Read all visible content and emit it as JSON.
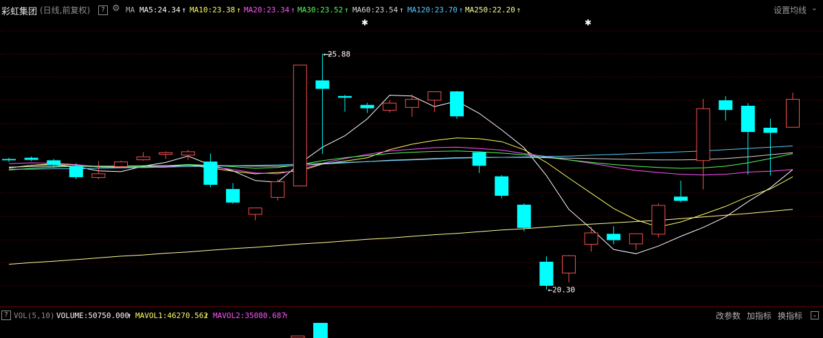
{
  "header": {
    "stock_name": "彩虹集团",
    "mode": "(日线,前复权)",
    "help": "?",
    "ma_label": "MA",
    "setting_label": "设置均线",
    "dropdown_glyph": "⌄",
    "indicators": [
      {
        "text": "MA5:24.34",
        "arrow": "↑",
        "color": "#ffffff"
      },
      {
        "text": "MA10:23.38",
        "arrow": "↑",
        "color": "#ffff66"
      },
      {
        "text": "MA20:23.34",
        "arrow": "↑",
        "color": "#ff55ff"
      },
      {
        "text": "MA30:23.52",
        "arrow": "↑",
        "color": "#55ff55"
      },
      {
        "text": "MA60:23.54",
        "arrow": "↑",
        "color": "#d8d8d8"
      },
      {
        "text": "MA120:23.70",
        "arrow": "↑",
        "color": "#55ccff"
      },
      {
        "text": "MA250:22.20",
        "arrow": "↑",
        "color": "#ffff99"
      }
    ]
  },
  "volume_panel": {
    "help": "?",
    "label": "VOL(5,10)",
    "volume": "VOLUME:50750.000",
    "volume_arrow": "↑",
    "mavol1": "MAVOL1:46270.562",
    "mavol1_arrow": "↑",
    "mavol2": "MAVOL2:35080.687",
    "mavol2_arrow": "↑",
    "buttons": [
      "改参数",
      "加指标",
      "换指标"
    ],
    "dropdown_glyph": "⌄"
  },
  "colors": {
    "up": "#ff5050",
    "down": "#00ffff",
    "grid": "#8b0000",
    "label": "#ffffff"
  },
  "chart_data": {
    "type": "candlestick",
    "ylim": [
      20.0,
      26.6
    ],
    "annotations": [
      {
        "label": "25.88",
        "value": 25.88,
        "kind": "high"
      },
      {
        "label": "20.30",
        "value": 20.3,
        "kind": "low"
      }
    ],
    "event_markers": [
      "✱",
      "✱"
    ],
    "candles": [
      {
        "o": 23.39,
        "h": 23.42,
        "l": 23.32,
        "c": 23.36
      },
      {
        "o": 23.42,
        "h": 23.45,
        "l": 23.34,
        "c": 23.37
      },
      {
        "o": 23.36,
        "h": 23.39,
        "l": 23.18,
        "c": 23.25
      },
      {
        "o": 23.22,
        "h": 23.29,
        "l": 22.91,
        "c": 22.96
      },
      {
        "o": 22.96,
        "h": 23.34,
        "l": 22.91,
        "c": 23.05
      },
      {
        "o": 23.22,
        "h": 23.35,
        "l": 23.17,
        "c": 23.33
      },
      {
        "o": 23.38,
        "h": 23.55,
        "l": 23.35,
        "c": 23.45
      },
      {
        "o": 23.51,
        "h": 23.57,
        "l": 23.39,
        "c": 23.55
      },
      {
        "o": 23.49,
        "h": 23.61,
        "l": 23.37,
        "c": 23.57
      },
      {
        "o": 23.33,
        "h": 23.52,
        "l": 22.72,
        "c": 22.78
      },
      {
        "o": 22.68,
        "h": 22.82,
        "l": 22.33,
        "c": 22.36
      },
      {
        "o": 22.09,
        "h": 22.24,
        "l": 21.94,
        "c": 22.24
      },
      {
        "o": 22.49,
        "h": 22.91,
        "l": 22.41,
        "c": 22.86
      },
      {
        "o": 22.76,
        "h": 25.62,
        "l": 22.74,
        "c": 25.62
      },
      {
        "o": 25.25,
        "h": 25.88,
        "l": 23.51,
        "c": 25.05
      },
      {
        "o": 24.88,
        "h": 24.91,
        "l": 24.51,
        "c": 24.84
      },
      {
        "o": 24.67,
        "h": 24.72,
        "l": 24.48,
        "c": 24.59
      },
      {
        "o": 24.55,
        "h": 24.78,
        "l": 24.49,
        "c": 24.72
      },
      {
        "o": 24.62,
        "h": 24.92,
        "l": 24.39,
        "c": 24.81
      },
      {
        "o": 24.79,
        "h": 24.99,
        "l": 24.5,
        "c": 24.99
      },
      {
        "o": 24.99,
        "h": 25.0,
        "l": 24.34,
        "c": 24.4
      },
      {
        "o": 23.55,
        "h": 23.57,
        "l": 23.06,
        "c": 23.23
      },
      {
        "o": 22.98,
        "h": 23.01,
        "l": 22.46,
        "c": 22.52
      },
      {
        "o": 22.31,
        "h": 22.34,
        "l": 21.68,
        "c": 21.76
      },
      {
        "o": 20.96,
        "h": 21.09,
        "l": 20.3,
        "c": 20.39
      },
      {
        "o": 20.7,
        "h": 21.12,
        "l": 20.47,
        "c": 21.11
      },
      {
        "o": 21.38,
        "h": 21.79,
        "l": 21.2,
        "c": 21.65
      },
      {
        "o": 21.62,
        "h": 21.8,
        "l": 21.37,
        "c": 21.47
      },
      {
        "o": 21.39,
        "h": 21.63,
        "l": 21.24,
        "c": 21.63
      },
      {
        "o": 21.62,
        "h": 22.34,
        "l": 21.53,
        "c": 22.3
      },
      {
        "o": 22.5,
        "h": 22.88,
        "l": 22.37,
        "c": 22.4
      },
      {
        "o": 23.36,
        "h": 24.81,
        "l": 22.67,
        "c": 24.59
      },
      {
        "o": 24.78,
        "h": 24.88,
        "l": 24.3,
        "c": 24.55
      },
      {
        "o": 24.65,
        "h": 24.71,
        "l": 23.02,
        "c": 24.03
      },
      {
        "o": 24.13,
        "h": 24.34,
        "l": 23.0,
        "c": 24.01
      },
      {
        "o": 24.15,
        "h": 24.96,
        "l": 24.15,
        "c": 24.81
      }
    ],
    "series": [
      {
        "name": "MA5",
        "color": "#ffffff",
        "values": [
          23.18,
          23.24,
          23.26,
          23.21,
          23.11,
          23.09,
          23.22,
          23.31,
          23.46,
          23.25,
          23.11,
          22.88,
          22.84,
          23.29,
          23.67,
          23.94,
          24.34,
          24.9,
          24.88,
          24.63,
          24.76,
          24.47,
          24.08,
          23.66,
          23.0,
          22.2,
          21.74,
          21.25,
          21.15,
          21.33,
          21.56,
          21.77,
          22.02,
          22.38,
          22.71,
          23.14
        ]
      },
      {
        "name": "MA10",
        "color": "#ffff66",
        "values": [
          23.18,
          23.24,
          23.28,
          23.25,
          23.21,
          23.21,
          23.19,
          23.2,
          23.25,
          23.18,
          23.1,
          23.04,
          23.07,
          23.11,
          23.27,
          23.34,
          23.42,
          23.61,
          23.74,
          23.83,
          23.89,
          23.87,
          23.8,
          23.61,
          23.31,
          22.94,
          22.58,
          22.22,
          21.95,
          21.78,
          21.9,
          22.08,
          22.27,
          22.5,
          22.68,
          22.97
        ]
      },
      {
        "name": "MA20",
        "color": "#ff55ff",
        "values": [
          23.28,
          23.3,
          23.29,
          23.26,
          23.2,
          23.18,
          23.2,
          23.21,
          23.25,
          23.21,
          23.14,
          23.06,
          23.04,
          23.14,
          23.29,
          23.4,
          23.5,
          23.58,
          23.62,
          23.66,
          23.67,
          23.64,
          23.6,
          23.52,
          23.45,
          23.37,
          23.29,
          23.2,
          23.12,
          23.07,
          23.03,
          23.01,
          23.03,
          23.08,
          23.1,
          23.14
        ]
      },
      {
        "name": "MA30",
        "color": "#55ff55",
        "values": [
          23.13,
          23.17,
          23.2,
          23.22,
          23.21,
          23.2,
          23.21,
          23.23,
          23.26,
          23.24,
          23.21,
          23.17,
          23.19,
          23.26,
          23.35,
          23.42,
          23.47,
          23.52,
          23.55,
          23.57,
          23.58,
          23.56,
          23.53,
          23.49,
          23.43,
          23.37,
          23.31,
          23.26,
          23.22,
          23.19,
          23.17,
          23.18,
          23.22,
          23.3,
          23.4,
          23.52
        ]
      },
      {
        "name": "MA60",
        "color": "#d8d8d8",
        "values": [
          23.2,
          23.21,
          23.22,
          23.22,
          23.22,
          23.22,
          23.23,
          23.23,
          23.24,
          23.24,
          23.23,
          23.22,
          23.22,
          23.24,
          23.27,
          23.3,
          23.33,
          23.36,
          23.38,
          23.4,
          23.42,
          23.43,
          23.43,
          23.43,
          23.42,
          23.41,
          23.4,
          23.39,
          23.38,
          23.37,
          23.37,
          23.38,
          23.4,
          23.44,
          23.49,
          23.54
        ]
      },
      {
        "name": "MA120",
        "color": "#55ccff",
        "values": [
          23.15,
          23.15,
          23.16,
          23.16,
          23.17,
          23.18,
          23.19,
          23.2,
          23.21,
          23.22,
          23.23,
          23.24,
          23.25,
          23.27,
          23.29,
          23.31,
          23.33,
          23.35,
          23.37,
          23.39,
          23.41,
          23.42,
          23.43,
          23.44,
          23.45,
          23.46,
          23.48,
          23.5,
          23.52,
          23.54,
          23.56,
          23.58,
          23.61,
          23.64,
          23.67,
          23.7
        ]
      },
      {
        "name": "MA250",
        "color": "#ffff99",
        "values": [
          20.9,
          20.94,
          20.97,
          21.01,
          21.05,
          21.09,
          21.12,
          21.16,
          21.19,
          21.23,
          21.27,
          21.3,
          21.34,
          21.38,
          21.41,
          21.45,
          21.49,
          21.52,
          21.56,
          21.6,
          21.63,
          21.67,
          21.71,
          21.74,
          21.78,
          21.82,
          21.85,
          21.88,
          21.91,
          21.94,
          21.98,
          22.02,
          22.06,
          22.1,
          22.15,
          22.2
        ]
      }
    ]
  }
}
